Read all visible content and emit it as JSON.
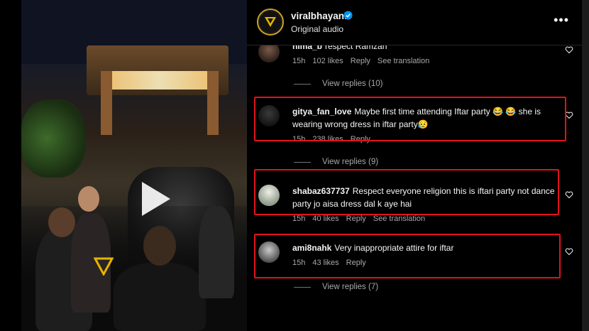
{
  "post": {
    "username": "viralbhayani",
    "audio": "Original audio",
    "more_label": "•••"
  },
  "comments": [
    {
      "username": "nima_b",
      "text": "respect Ramzan",
      "time": "15h",
      "likes": "102 likes",
      "reply": "Reply",
      "translation": "See translation",
      "view_replies": "View replies (10)"
    },
    {
      "username": "gitya_fan_love",
      "text": "Maybe first time attending Iftar party 😂 😂  she is wearing wrong dress in iftar party😥",
      "time": "15h",
      "likes": "238 likes",
      "reply": "Reply",
      "view_replies": "View replies (9)"
    },
    {
      "username": "shabaz637737",
      "text": "Respect everyone religion this is iftari party not dance party jo aisa dress dal k aye hai",
      "time": "15h",
      "likes": "40 likes",
      "reply": "Reply",
      "translation": "See translation"
    },
    {
      "username": "ami8nahk",
      "text": "Very inappropriate attire for iftar",
      "time": "15h",
      "likes": "43 likes",
      "reply": "Reply",
      "view_replies": "View replies (7)"
    }
  ],
  "colors": {
    "highlight": "#e3121b",
    "verified": "#0095f6",
    "brand_gold": "#c9a227"
  }
}
